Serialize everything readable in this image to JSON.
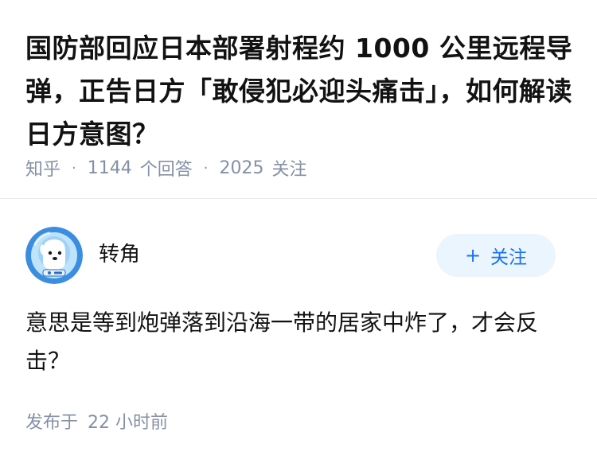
{
  "question": {
    "title": "国防部回应日本部署射程约 1000 公里远程导弹，正告日方「敢侵犯必迎头痛击」，如何解读日方意图？",
    "source": "知乎",
    "answer_count": "1144",
    "answer_label": "个回答",
    "follower_count": "2025",
    "follower_label": "关注"
  },
  "answer": {
    "author_name": "转角",
    "follow_button": {
      "icon": "+",
      "label": "关注"
    },
    "content": "意思是等到炮弹落到沿海一带的居家中炸了，才会反击？",
    "publish_label": "发布于",
    "publish_time": "22 小时前"
  },
  "colors": {
    "text_primary": "#121212",
    "text_secondary": "#8590a6",
    "accent": "#1772f6",
    "follow_bg": "#ebf5fd",
    "avatar_bg": "#3b8de0"
  }
}
